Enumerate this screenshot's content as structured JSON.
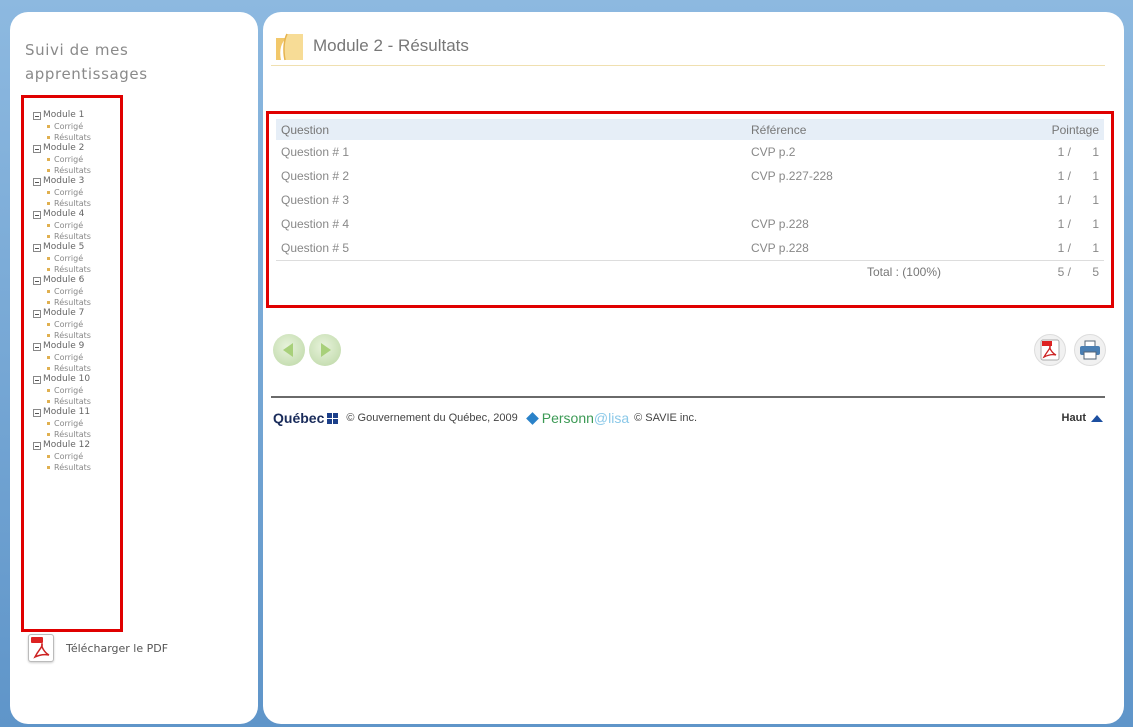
{
  "sidebar": {
    "title": "Suivi de mes apprentissages",
    "modules": [
      {
        "label": "Module 1",
        "children": [
          "Corrigé",
          "Résultats"
        ]
      },
      {
        "label": "Module 2",
        "children": [
          "Corrigé",
          "Résultats"
        ]
      },
      {
        "label": "Module 3",
        "children": [
          "Corrigé",
          "Résultats"
        ]
      },
      {
        "label": "Module 4",
        "children": [
          "Corrigé",
          "Résultats"
        ]
      },
      {
        "label": "Module 5",
        "children": [
          "Corrigé",
          "Résultats"
        ]
      },
      {
        "label": "Module 6",
        "children": [
          "Corrigé",
          "Résultats"
        ]
      },
      {
        "label": "Module 7",
        "children": [
          "Corrigé",
          "Résultats"
        ]
      },
      {
        "label": "Module 9",
        "children": [
          "Corrigé",
          "Résultats"
        ]
      },
      {
        "label": "Module 10",
        "children": [
          "Corrigé",
          "Résultats"
        ]
      },
      {
        "label": "Module 11",
        "children": [
          "Corrigé",
          "Résultats"
        ]
      },
      {
        "label": "Module 12",
        "children": [
          "Corrigé",
          "Résultats"
        ]
      }
    ],
    "download_label": "Télécharger le PDF"
  },
  "main": {
    "title": "Module 2 - Résultats",
    "table": {
      "headers": {
        "question": "Question",
        "reference": "Référence",
        "score": "Pointage"
      },
      "rows": [
        {
          "question": "Question # 1",
          "reference": "CVP p.2",
          "score": "1 /",
          "max": "1"
        },
        {
          "question": "Question # 2",
          "reference": "CVP p.227-228",
          "score": "1 /",
          "max": "1"
        },
        {
          "question": "Question # 3",
          "reference": "",
          "score": "1 /",
          "max": "1"
        },
        {
          "question": "Question # 4",
          "reference": "CVP p.228",
          "score": "1 /",
          "max": "1"
        },
        {
          "question": "Question # 5",
          "reference": "CVP p.228",
          "score": "1 /",
          "max": "1"
        }
      ],
      "total": {
        "label": "Total : (100%)",
        "score": "5 /",
        "max": "5"
      }
    }
  },
  "footer": {
    "quebec": "Québec",
    "copyright": "© Gouvernement du Québec, 2009",
    "persona_main": "Personn",
    "persona_accent": "@lisa",
    "savie": "© SAVIE inc.",
    "haut": "Haut"
  },
  "colors": {
    "highlight": "#e00000",
    "background": "#6a9fd0",
    "nav_arrow": "#c8dfb4"
  }
}
